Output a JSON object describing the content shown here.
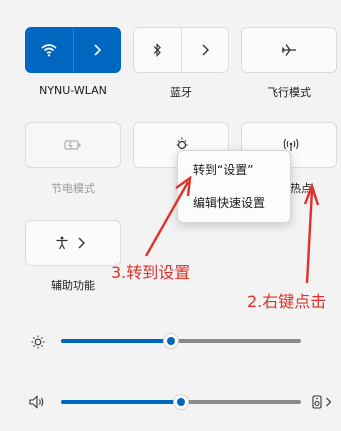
{
  "quick_settings": {
    "wifi": {
      "label": "NYNU-WLAN",
      "state": "on"
    },
    "bluetooth": {
      "label": "蓝牙",
      "state": "off"
    },
    "airplane": {
      "label": "飞行模式",
      "state": "off"
    },
    "battery_saver": {
      "label": "节电模式",
      "state": "disabled"
    },
    "night_light": {
      "label": "夜间"
    },
    "hotspot": {
      "label": "热点"
    },
    "accessibility": {
      "label": "辅助功能"
    }
  },
  "context_menu": {
    "items": [
      "转到“设置”",
      "编辑快速设置"
    ]
  },
  "brightness": {
    "level": 0.46
  },
  "volume": {
    "level": 0.5
  },
  "annotations": {
    "step2": "2.右键点击",
    "step3": "3.转到设置"
  },
  "colors": {
    "accent": "#0067c0",
    "annotation": "#e0302a"
  }
}
